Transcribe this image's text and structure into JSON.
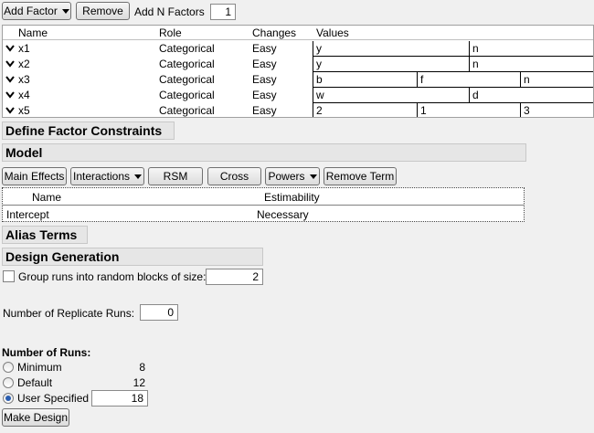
{
  "toolbar": {
    "add_factor_label": "Add Factor",
    "remove_label": "Remove",
    "add_n_factors_label": "Add N Factors",
    "add_n_factors_value": "1"
  },
  "factors": {
    "headers": {
      "name": "Name",
      "role": "Role",
      "changes": "Changes",
      "values": "Values"
    },
    "rows": [
      {
        "name": "x1",
        "role": "Categorical",
        "changes": "Easy",
        "values": [
          "y",
          "n"
        ]
      },
      {
        "name": "x2",
        "role": "Categorical",
        "changes": "Easy",
        "values": [
          "y",
          "n"
        ]
      },
      {
        "name": "x3",
        "role": "Categorical",
        "changes": "Easy",
        "values": [
          "b",
          "f",
          "n"
        ]
      },
      {
        "name": "x4",
        "role": "Categorical",
        "changes": "Easy",
        "values": [
          "w",
          "d"
        ]
      },
      {
        "name": "x5",
        "role": "Categorical",
        "changes": "Easy",
        "values": [
          "2",
          "1",
          "3"
        ]
      }
    ]
  },
  "sections": {
    "define_constraints": "Define Factor Constraints",
    "model": "Model",
    "alias_terms": "Alias Terms",
    "design_generation": "Design Generation"
  },
  "model_buttons": {
    "main_effects": "Main Effects",
    "interactions": "Interactions",
    "rsm": "RSM",
    "cross": "Cross",
    "powers": "Powers",
    "remove_term": "Remove Term"
  },
  "model_table": {
    "headers": {
      "name": "Name",
      "estimability": "Estimability"
    },
    "rows": [
      {
        "name": "Intercept",
        "estimability": "Necessary"
      }
    ]
  },
  "design_generation": {
    "group_runs_label": "Group runs into random blocks of size:",
    "group_runs_checked": false,
    "block_size": "2",
    "replicate_label": "Number of Replicate Runs:",
    "replicate_value": "0",
    "number_of_runs_label": "Number of Runs:",
    "runs": [
      {
        "label": "Minimum",
        "value": "8",
        "selected": false
      },
      {
        "label": "Default",
        "value": "12",
        "selected": false
      },
      {
        "label": "User Specified",
        "value": "18",
        "selected": true
      }
    ],
    "make_design_label": "Make Design"
  }
}
